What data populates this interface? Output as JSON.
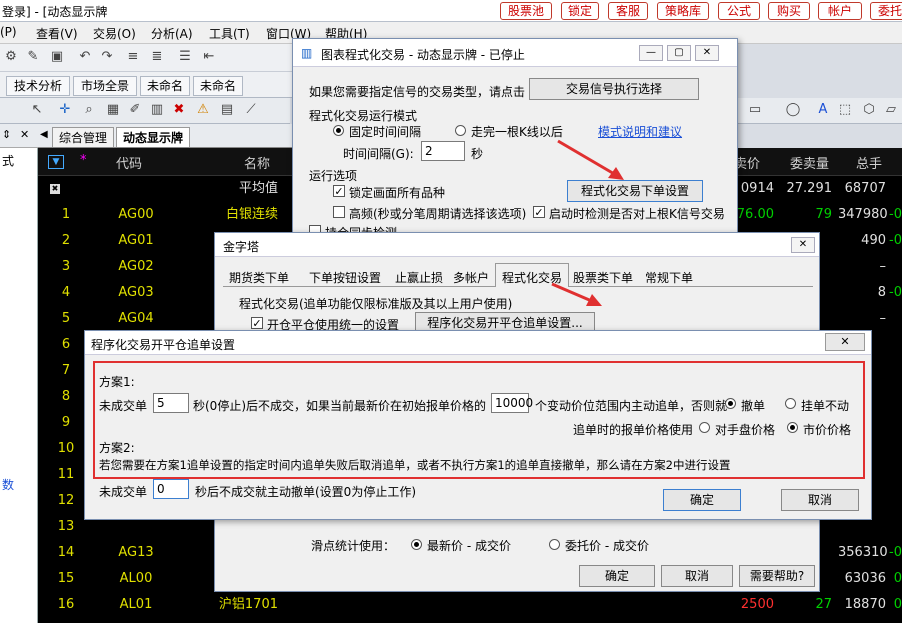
{
  "app": {
    "title": "登录] - [动态显示牌",
    "quick_buttons": [
      "股票池",
      "锁定",
      "客服",
      "策略库",
      "公式",
      "购买",
      "帐户",
      "委托"
    ]
  },
  "menu": [
    "(P)",
    "查看(V)",
    "交易(O)",
    "分析(A)",
    "工具(T)",
    "窗口(W)",
    "帮助(H)"
  ],
  "section_tabs": [
    "技术分析",
    "市场全景",
    "未命名",
    "未命名"
  ],
  "left_pane": {
    "label_top": "式",
    "label_bottom": "数"
  },
  "page_tabs": [
    "综合管理",
    "动态显示牌"
  ],
  "grid": {
    "headers": {
      "star": "*",
      "code": "代码",
      "name": "名称",
      "ask": "卖价",
      "ask_qty": "委卖量",
      "total": "总手"
    },
    "avg_row": {
      "name": "平均值",
      "ask": "0914",
      "ask_qty": "27.291",
      "total": "68707"
    },
    "rows": [
      {
        "num": "1",
        "code": "AG00",
        "name": "白银连续",
        "ask": "76.00",
        "ask_qty": "79",
        "total": "347980",
        "tail": "-0"
      },
      {
        "num": "2",
        "code": "AG01",
        "name": "",
        "ask": "",
        "ask_qty": "",
        "total": "490",
        "tail": "-0"
      },
      {
        "num": "3",
        "code": "AG02",
        "name": "",
        "ask": "",
        "ask_qty": "",
        "total": "–",
        "tail": ""
      },
      {
        "num": "4",
        "code": "AG03",
        "name": "",
        "ask": "",
        "ask_qty": "",
        "total": "8",
        "tail": "-0"
      },
      {
        "num": "5",
        "code": "AG04",
        "name": "",
        "ask": "",
        "ask_qty": "",
        "total": "–",
        "tail": ""
      },
      {
        "num": "6",
        "code": "",
        "name": "",
        "ask": "",
        "ask_qty": "",
        "total": "",
        "tail": ""
      },
      {
        "num": "7",
        "code": "",
        "name": "",
        "ask": "",
        "ask_qty": "",
        "total": "",
        "tail": ""
      },
      {
        "num": "8",
        "code": "",
        "name": "",
        "ask": "",
        "ask_qty": "",
        "total": "",
        "tail": ""
      },
      {
        "num": "9",
        "code": "",
        "name": "",
        "ask": "",
        "ask_qty": "",
        "total": "",
        "tail": ""
      },
      {
        "num": "10",
        "code": "",
        "name": "",
        "ask": "",
        "ask_qty": "",
        "total": "",
        "tail": ""
      },
      {
        "num": "11",
        "code": "",
        "name": "",
        "ask": "",
        "ask_qty": "",
        "total": "",
        "tail": ""
      },
      {
        "num": "12",
        "code": "",
        "name": "",
        "ask": "",
        "ask_qty": "",
        "total": "",
        "tail": ""
      },
      {
        "num": "13",
        "code": "",
        "name": "",
        "ask": "",
        "ask_qty": "",
        "total": "",
        "tail": ""
      },
      {
        "num": "14",
        "code": "AG13",
        "name": "",
        "ask": "",
        "ask_qty": "",
        "total": "356310",
        "tail": "-0"
      },
      {
        "num": "15",
        "code": "AL00",
        "name": "",
        "ask": "",
        "ask_qty": "",
        "total": "63036",
        "tail": "0"
      },
      {
        "num": "16",
        "code": "AL01",
        "name": "沪铝1701",
        "ask": "2500",
        "ask_qty": "27",
        "total": "18870",
        "tail": "0"
      }
    ]
  },
  "chart_trade_window": {
    "title": "图表程式化交易 - 动态显示牌 - 已停止",
    "signal_prompt": "如果您需要指定信号的交易类型，请点击",
    "signal_button": "交易信号执行选择",
    "mode_title": "程式化交易运行模式",
    "mode_fixed": "固定时间间隔",
    "mode_kline": "走完一根K线以后",
    "mode_help": "模式说明和建议",
    "interval_label": "时间间隔(G):",
    "interval_value": "2",
    "interval_unit": "秒",
    "run_options": "运行选项",
    "lock_all": "锁定画面所有品种",
    "order_settings": "程式化交易下单设置",
    "high_freq": "高频(秒或分笔周期请选择该选项)",
    "auto_check": "启动时检测是否对上根K信号交易",
    "partial": "持仓同步检测"
  },
  "jinzita_window": {
    "title": "金字塔",
    "tabs": [
      "期货类下单",
      "下单按钮设置",
      "止赢止损",
      "多帐户",
      "程式化交易",
      "股票类下单",
      "常规下单"
    ],
    "section": "程式化交易(追单功能仅限标准版及其以上用户使用)",
    "unified": "开仓平仓使用统一的设置",
    "followup_btn": "程序化交易开平仓追单设置...",
    "slip_label": "滑点统计使用：",
    "slip_latest": "最新价 - 成交价",
    "slip_order": "委托价 - 成交价",
    "ok": "确定",
    "cancel": "取消",
    "help": "需要帮助?"
  },
  "followup_dialog": {
    "title": "程序化交易开平仓追单设置",
    "plan1": "方案1:",
    "unfilled": "未成交单",
    "seconds_value": "5",
    "plan1_text": "秒(0停止)后不成交，如果当前最新价在初始报单价格的",
    "ticks_value": "10000",
    "plan1_text2": "个变动价位范围内主动追单，否则就",
    "opt_cancel": "撤单",
    "opt_hold": "挂单不动",
    "price_label": "追单时的报单价格使用",
    "opt_counter": "对手盘价格",
    "opt_market": "市价价格",
    "plan2": "方案2:",
    "plan2_text": "若您需要在方案1追单设置的指定时间内追单失败后取消追单，或者不执行方案1的追单直接撤单，那么请在方案2中进行设置",
    "unfilled2": "未成交单",
    "seconds2_value": "0",
    "plan2_text2": "秒后不成交就主动撤单(设置0为停止工作)",
    "ok": "确定",
    "cancel": "取消"
  },
  "colors": {
    "highlight": "#e03030",
    "grid_yellow": "#e0e000",
    "grid_green": "#00d000",
    "grid_red": "#ff3030"
  }
}
